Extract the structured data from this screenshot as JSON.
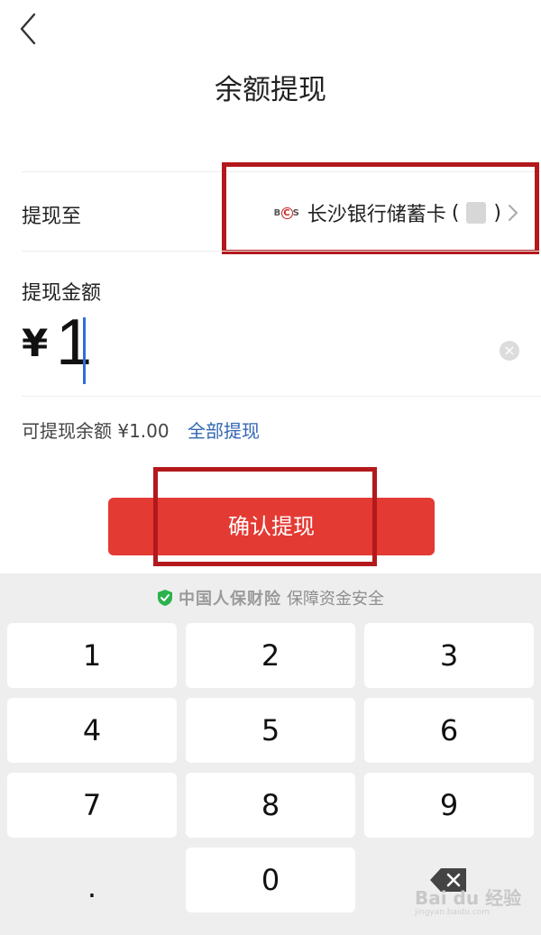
{
  "header": {
    "title": "余额提现"
  },
  "withdraw_to": {
    "label": "提现至",
    "bank_logo": "BCS",
    "bank_name": "长沙银行储蓄卡",
    "paren_open": "(",
    "paren_close": ")"
  },
  "amount": {
    "label": "提现金额",
    "currency": "¥",
    "value": "1",
    "clear_icon": "clear-circle-icon"
  },
  "balance": {
    "available_text": "可提现余额 ¥1.00",
    "withdraw_all": "全部提现"
  },
  "confirm_button": "确认提现",
  "safety": {
    "brand": "中国人保财险",
    "text": "保障资金安全",
    "icon": "shield-check-icon",
    "icon_color": "#2bb24c"
  },
  "keypad": {
    "keys": [
      "1",
      "2",
      "3",
      "4",
      "5",
      "6",
      "7",
      "8",
      "9",
      ".",
      "0"
    ],
    "backspace_icon": "backspace-icon"
  },
  "watermark": {
    "main": "Bai du 经验",
    "sub": "jingyan.baidu.com"
  },
  "colors": {
    "accent": "#e33a33",
    "highlight_box": "#b3191c",
    "link": "#3366b3",
    "caret": "#2e6fd8"
  }
}
